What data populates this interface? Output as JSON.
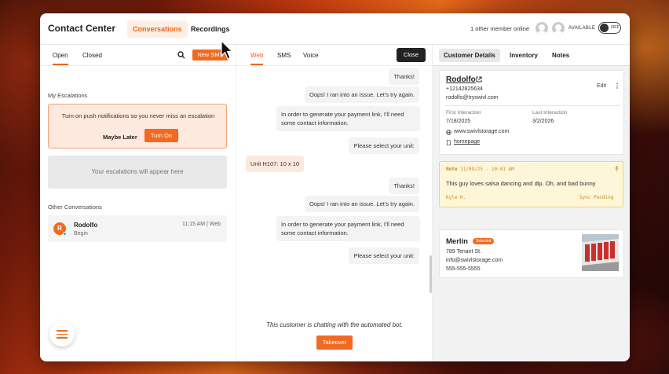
{
  "header": {
    "title": "Contact Center",
    "tabs": [
      {
        "label": "Conversations",
        "active": true
      },
      {
        "label": "Recordings",
        "active": false
      }
    ],
    "online_status": "1 other member online",
    "availability_label": "AVAILABLE",
    "toggle_state": "OFF"
  },
  "left": {
    "tabs": [
      {
        "label": "Open",
        "active": true
      },
      {
        "label": "Closed",
        "active": false
      }
    ],
    "new_sms_label": "New SMS",
    "escalations_heading": "My Escalations",
    "notification": {
      "text": "Turn on push notifications so you never miss an escalation",
      "maybe_later": "Maybe Later",
      "turn_on": "Turn On"
    },
    "escalations_empty": "Your escalations will appear here",
    "other_heading": "Other Conversations",
    "conversations": [
      {
        "initial": "R",
        "name": "Rodolfo",
        "preview": "Begin",
        "time": "11:15 AM | Web"
      }
    ]
  },
  "chat": {
    "tabs": [
      {
        "label": "Web",
        "active": true
      },
      {
        "label": "SMS",
        "active": false
      },
      {
        "label": "Voice",
        "active": false
      }
    ],
    "close_label": "Close",
    "messages": [
      {
        "dir": "out",
        "text": "Thanks!"
      },
      {
        "dir": "out",
        "text": "Oops! I ran into an issue. Let's try again."
      },
      {
        "dir": "out",
        "text": "In order to generate your payment link, I'll need some contact information."
      },
      {
        "dir": "out",
        "text": "Please select your unit:"
      },
      {
        "dir": "in",
        "text": "Unit H107: 10 x 10"
      },
      {
        "dir": "out",
        "text": "Thanks!"
      },
      {
        "dir": "out",
        "text": "Oops! I ran into an issue. Let's try again."
      },
      {
        "dir": "out",
        "text": "In order to generate your payment link, I'll need some contact information."
      },
      {
        "dir": "out",
        "text": "Please select your unit:"
      }
    ],
    "bot_notice": "This customer is chatting with the automated bot.",
    "takeover_label": "Takeover"
  },
  "details": {
    "tabs": [
      {
        "label": "Customer Details",
        "active": true
      },
      {
        "label": "Inventory",
        "active": false
      },
      {
        "label": "Notes",
        "active": false
      }
    ],
    "customer": {
      "name": "Rodolfo",
      "phone": "+12142825634",
      "email": "rodolfo@tryswivl.com",
      "edit_label": "Edit",
      "first_interaction_label": "First Interaction",
      "first_interaction": "7/18/2025",
      "last_interaction_label": "Last Interaction",
      "last_interaction": "3/2/2026",
      "website": "www.swivlstorage.com",
      "homepage": "homepage"
    },
    "note": {
      "label": "Note",
      "timestamp": "11/09/25  -  10:41 AM",
      "body": "This guy loves salsa dancing and dip. Oh, and bad bunny",
      "author": "Kyle H.",
      "status": "Sync Pending"
    },
    "facility": {
      "name": "Merlin",
      "badge": "Selected",
      "address": "789 Tenant St.",
      "email": "info@swivlstorage.com",
      "phone": "555-555-5555"
    }
  },
  "colors": {
    "accent": "#f26a21",
    "accent_light": "#fde9de",
    "note_bg": "#fdf6d8"
  }
}
